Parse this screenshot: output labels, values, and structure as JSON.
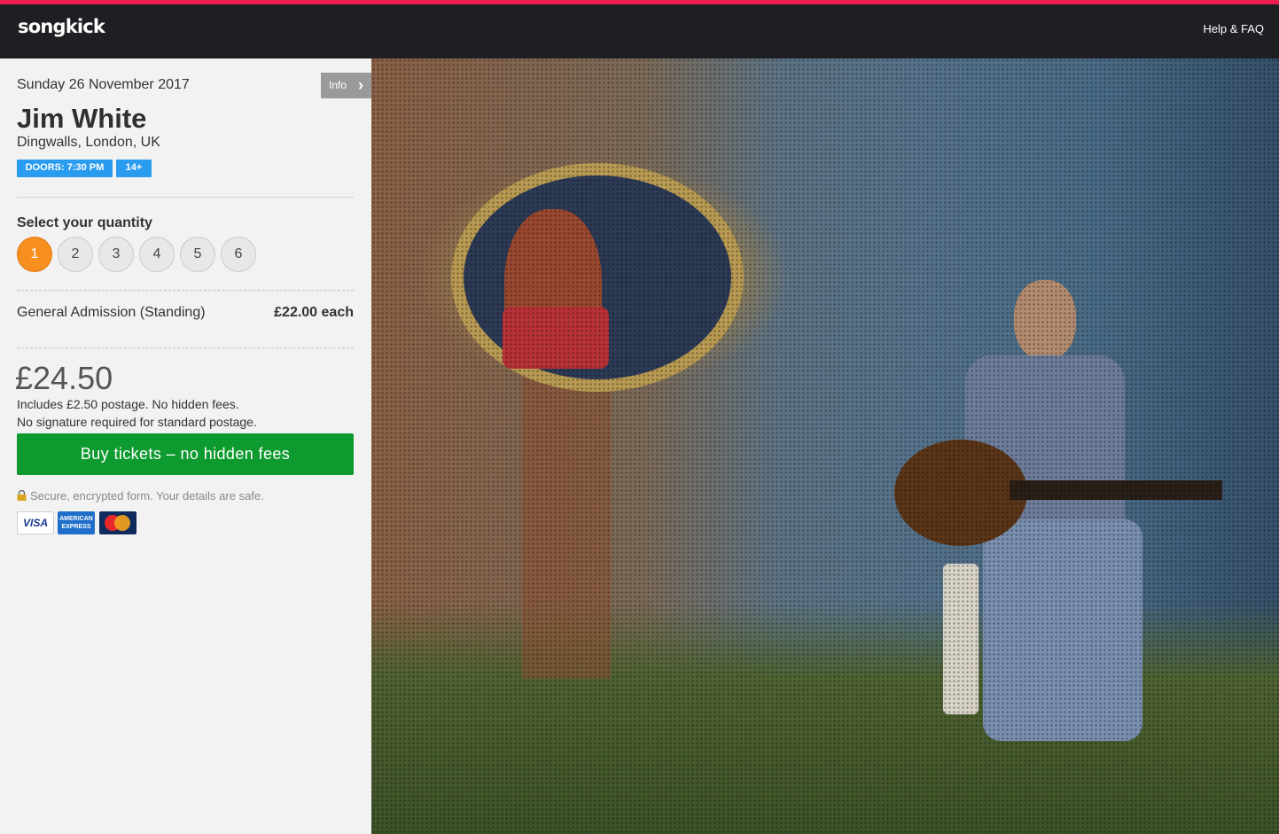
{
  "header": {
    "logo": "songkick",
    "help_link": "Help & FAQ"
  },
  "event": {
    "date": "Sunday 26 November 2017",
    "info_button": "Info",
    "artist": "Jim White",
    "venue": "Dingwalls, London, UK",
    "doors_badge": "DOORS: 7:30 PM",
    "age_badge": "14+"
  },
  "quantity": {
    "label": "Select your quantity",
    "options": [
      "1",
      "2",
      "3",
      "4",
      "5",
      "6"
    ],
    "selected": "1"
  },
  "ticket": {
    "name": "General Admission (Standing)",
    "price": "£22.00 each"
  },
  "summary": {
    "total": "£24.50",
    "postage_note": "Includes £2.50 postage. No hidden fees.",
    "signature_note": "No signature required for standard postage."
  },
  "buy_button": "Buy tickets – no hidden fees",
  "secure_text": "Secure, encrypted form. Your details are safe.",
  "payment_cards": [
    "VISA",
    "AMERICAN EXPRESS",
    "MasterCard"
  ],
  "colors": {
    "accent_bar": "#f01e4e",
    "badge_blue": "#2a9cf0",
    "selected_quantity": "#f78f1f",
    "buy_green": "#0d9a2e"
  }
}
